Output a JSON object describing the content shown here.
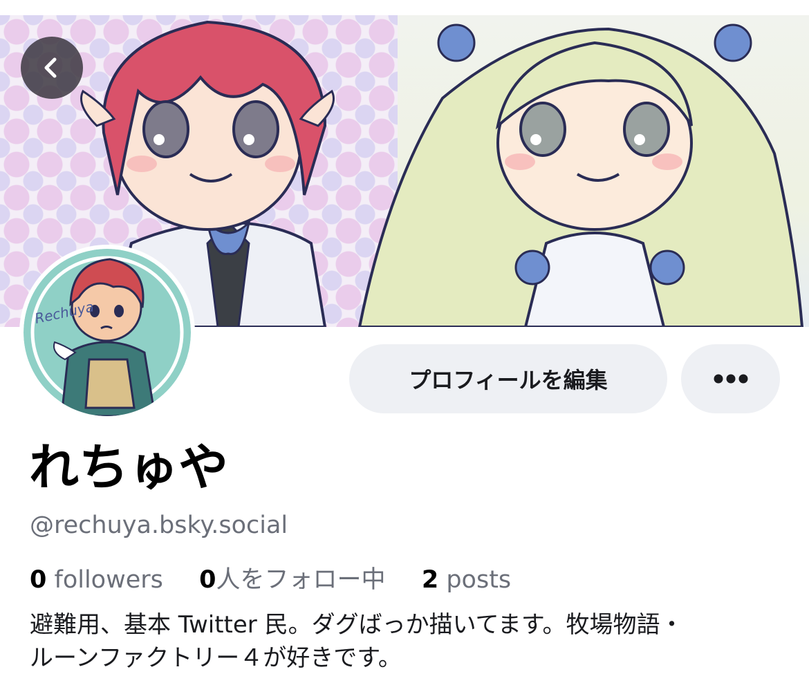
{
  "header": {
    "back_icon": "chevron-left-icon"
  },
  "profile": {
    "display_name": "れちゅや",
    "handle": "@rechuya.bsky.social",
    "avatar_text": "Rechuya",
    "edit_button_label": "プロフィールを編集",
    "more_icon": "ellipsis-icon",
    "stats": {
      "followers_count": "0",
      "followers_label": "followers",
      "following_count": "0",
      "following_label": "人をフォロー中",
      "posts_count": "2",
      "posts_label": "posts"
    },
    "bio_line1": "避難用、基本 Twitter 民。ダグばっか描いてます。牧場物語・",
    "bio_line2": "ルーンファクトリー４が好きです。"
  },
  "colors": {
    "button_bg": "#eef0f4",
    "muted_text": "#6b6f79",
    "back_button_bg": "#3c3741"
  }
}
